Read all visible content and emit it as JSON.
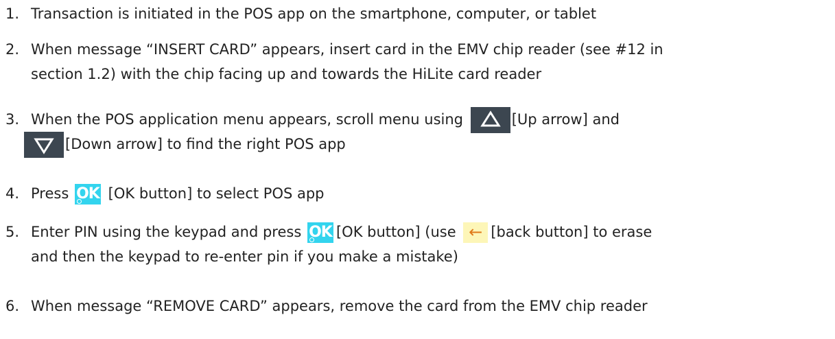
{
  "steps": [
    {
      "number": "1.",
      "text": "Transaction is initiated in the POS app on the smartphone, computer, or tablet"
    },
    {
      "number": "2.",
      "line1": "When message “INSERT CARD” appears, insert card in the EMV chip reader (see #12 in",
      "line2": "section 1.2)  with the chip facing up and towards the HiLite card reader"
    },
    {
      "number": "3.",
      "part1": "When the POS application menu appears, scroll menu using",
      "part2": "[Up arrow] and",
      "part3": "[Down arrow] to find the right POS app"
    },
    {
      "number": "4.",
      "part1": "Press",
      "part2": "[OK button] to select POS app"
    },
    {
      "number": "5.",
      "part1": "Enter PIN using the keypad and press",
      "part2": "[OK button] (use",
      "part3": "[back button] to erase",
      "line2": "and then the keypad to re-enter pin if you make a mistake)"
    },
    {
      "number": "6.",
      "text": "When message “REMOVE CARD” appears, remove the card from the EMV chip reader"
    }
  ],
  "buttons": {
    "ok_label": "OK",
    "back_glyph": "←",
    "up_icon": "up-arrow-triangle-icon",
    "down_icon": "down-arrow-triangle-icon"
  },
  "colors": {
    "dark_button": "#3c4650",
    "ok_button": "#33d4ee",
    "back_button_bg": "#fdf6b8",
    "back_arrow": "#e07a1a",
    "text": "#222222"
  }
}
